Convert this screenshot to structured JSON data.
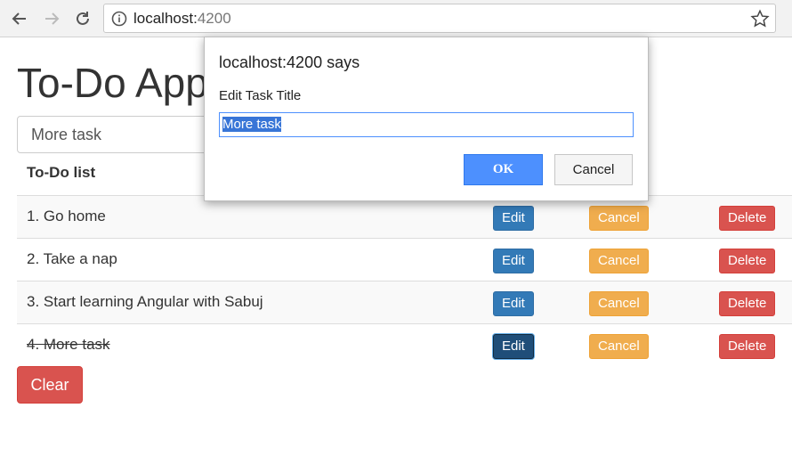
{
  "browser": {
    "url_host": "localhost:",
    "url_port": "4200",
    "icons": [
      "back-arrow-icon",
      "forward-arrow-icon",
      "reload-icon",
      "info-icon",
      "star-icon"
    ]
  },
  "app": {
    "title": "To-Do App",
    "input_value": "More task",
    "list_header": "To-Do list",
    "clear_label": "Clear"
  },
  "tasks": [
    {
      "text": "1. Go home",
      "done": false
    },
    {
      "text": "2. Take a nap",
      "done": false
    },
    {
      "text": "3. Start learning Angular with Sabuj",
      "done": false
    },
    {
      "text": "4. More task",
      "done": true
    }
  ],
  "row_buttons": {
    "edit": "Edit",
    "cancel": "Cancel",
    "delete": "Delete"
  },
  "dialog": {
    "title": "localhost:4200 says",
    "message": "Edit Task Title",
    "input_value": "More task",
    "ok_label": "OK",
    "cancel_label": "Cancel"
  },
  "colors": {
    "primary": "#337ab7",
    "warning": "#f0ad4e",
    "danger": "#d9534f",
    "dialog_ok": "#4d90fe"
  }
}
